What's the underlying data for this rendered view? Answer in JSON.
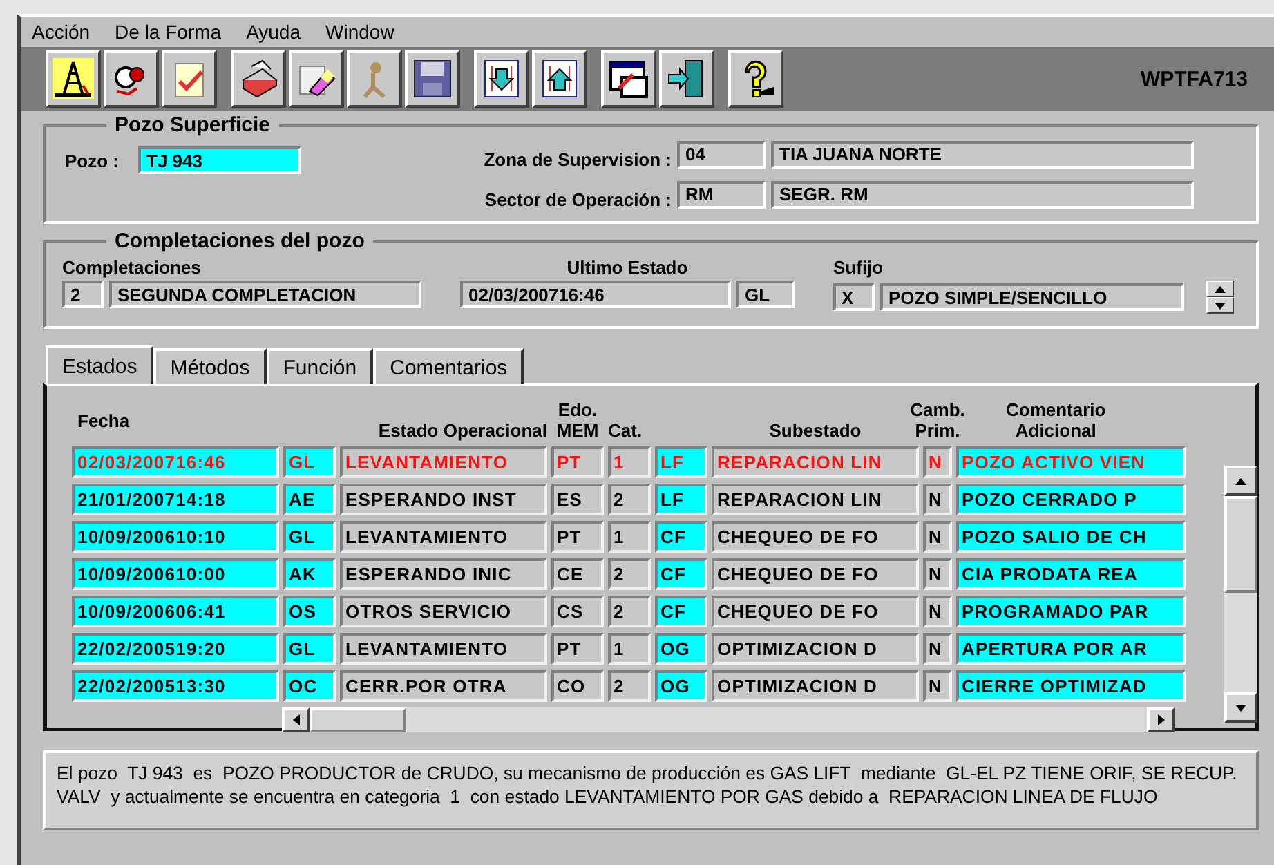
{
  "menu": [
    "Acción",
    "De la Forma",
    "Ayuda",
    "Window"
  ],
  "toolbar": {
    "form_id": "WPTFA713"
  },
  "pozo_superficie": {
    "title": "Pozo Superficie",
    "pozo_label": "Pozo :",
    "pozo_value": "TJ 943",
    "zona_label": "Zona de Supervision :",
    "zona_code": "04",
    "zona_name": "TIA JUANA NORTE",
    "sector_label": "Sector de Operación :",
    "sector_code": "RM",
    "sector_name": "SEGR. RM"
  },
  "completaciones": {
    "title": "Completaciones del pozo",
    "completaciones_label": "Completaciones",
    "ultimo_estado_label": "Ultimo Estado",
    "sufijo_label": "Sufijo",
    "completacion_num": "2",
    "completacion_name": "SEGUNDA COMPLETACION",
    "ultimo_fecha": "02/03/200716:46",
    "ultimo_code": "GL",
    "sufijo_code": "X",
    "sufijo_name": "POZO SIMPLE/SENCILLO"
  },
  "tabs": [
    {
      "label": "Estados",
      "selected": true
    },
    {
      "label": "Métodos",
      "selected": false
    },
    {
      "label": "Función",
      "selected": false
    },
    {
      "label": "Comentarios",
      "selected": false
    }
  ],
  "table": {
    "headers": [
      "Fecha",
      "Estado Operacional",
      "Edo.\nMEM",
      "Cat.",
      "Subestado",
      "Camb.\nPrim.",
      "Comentario\nAdicional"
    ],
    "rows": [
      {
        "current": true,
        "cells": [
          "02/03/200716:46",
          "GL",
          "LEVANTAMIENTO",
          "PT",
          "1",
          "LF",
          "REPARACION LIN",
          "N",
          "POZO ACTIVO VIEN"
        ]
      },
      {
        "current": false,
        "cells": [
          "21/01/200714:18",
          "AE",
          "ESPERANDO INST",
          "ES",
          "2",
          "LF",
          "REPARACION LIN",
          "N",
          "POZO CERRADO P"
        ]
      },
      {
        "current": false,
        "cells": [
          "10/09/200610:10",
          "GL",
          "LEVANTAMIENTO",
          "PT",
          "1",
          "CF",
          "CHEQUEO DE FO",
          "N",
          "POZO SALIO DE CH"
        ]
      },
      {
        "current": false,
        "cells": [
          "10/09/200610:00",
          "AK",
          "ESPERANDO INIC",
          "CE",
          "2",
          "CF",
          "CHEQUEO DE FO",
          "N",
          "CIA PRODATA REA"
        ]
      },
      {
        "current": false,
        "cells": [
          "10/09/200606:41",
          "OS",
          "OTROS SERVICIO",
          "CS",
          "2",
          "CF",
          "CHEQUEO DE FO",
          "N",
          "PROGRAMADO PAR"
        ]
      },
      {
        "current": false,
        "cells": [
          "22/02/200519:20",
          "GL",
          "LEVANTAMIENTO",
          "PT",
          "1",
          "OG",
          "OPTIMIZACION D",
          "N",
          "APERTURA POR AR"
        ]
      },
      {
        "current": false,
        "cells": [
          "22/02/200513:30",
          "OC",
          "CERR.POR OTRA",
          "CO",
          "2",
          "OG",
          "OPTIMIZACION D",
          "N",
          "CIERRE OPTIMIZAD"
        ]
      }
    ]
  },
  "message": "El pozo  TJ 943  es  POZO PRODUCTOR de CRUDO, su mecanismo de producción es GAS LIFT  mediante  GL-EL PZ TIENE ORIF, SE RECUP. VALV  y actualmente se encuentra en categoria  1  con estado LEVANTAMIENTO POR GAS debido a  REPARACION LINEA DE FLUJO"
}
